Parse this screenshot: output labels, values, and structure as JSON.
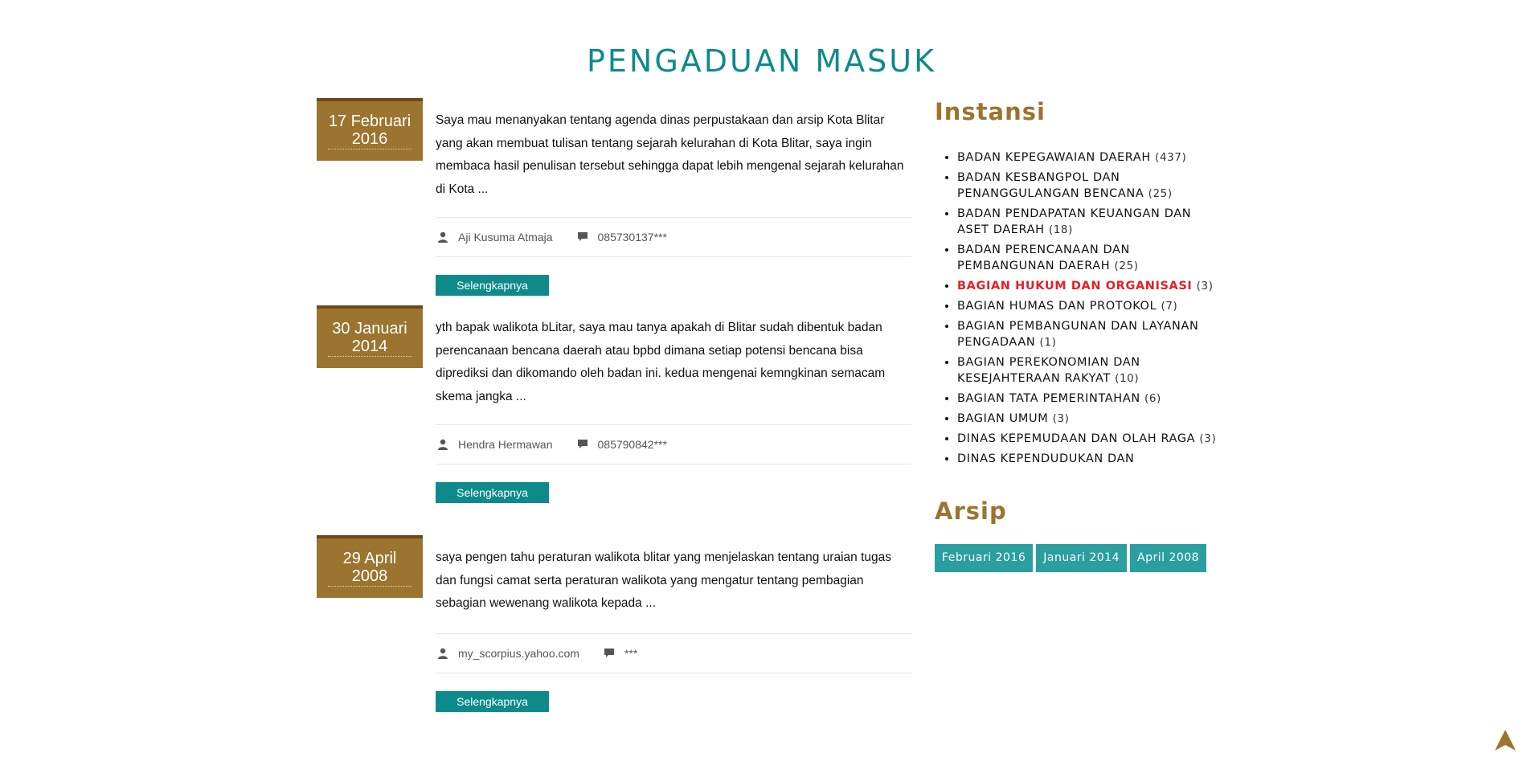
{
  "page": {
    "title": "PENGADUAN MASUK"
  },
  "posts": [
    {
      "date_line1": "17 Februari",
      "date_line2": "2016",
      "excerpt": "Saya mau menanyakan tentang agenda dinas perpustakaan dan arsip Kota Blitar yang akan membuat tulisan tentang sejarah kelurahan di Kota Blitar, saya ingin membaca hasil penulisan tersebut sehingga dapat lebih mengenal sejarah kelurahan di Kota ...",
      "author": "Aji Kusuma Atmaja",
      "phone": "085730137***",
      "button": "Selengkapnya"
    },
    {
      "date_line1": "30 Januari",
      "date_line2": "2014",
      "excerpt": "yth bapak walikota bLitar, saya mau tanya apakah di Blitar sudah dibentuk badan perencanaan bencana daerah atau bpbd dimana setiap potensi bencana bisa diprediksi dan dikomando oleh badan ini. kedua mengenai kemngkinan semacam skema jangka ...",
      "author": "Hendra Hermawan",
      "phone": "085790842***",
      "button": "Selengkapnya"
    },
    {
      "date_line1": "29 April",
      "date_line2": "2008",
      "excerpt": "saya pengen tahu peraturan walikota blitar yang menjelaskan tentang uraian tugas dan fungsi camat serta peraturan walikota yang mengatur tentang pembagian sebagian wewenang walikota kepada ...",
      "author": "my_scorpius.yahoo.com",
      "phone": "***",
      "button": "Selengkapnya"
    }
  ],
  "sidebar": {
    "instansi_heading": "Instansi",
    "instansi": [
      {
        "name": "BADAN KEPEGAWAIAN DAERAH",
        "count": "(437)"
      },
      {
        "name": "BADAN KESBANGPOL DAN PENANGGULANGAN BENCANA",
        "count": "(25)"
      },
      {
        "name": "BADAN PENDAPATAN KEUANGAN DAN ASET DAERAH",
        "count": "(18)"
      },
      {
        "name": "BADAN PERENCANAAN DAN PEMBANGUNAN DAERAH",
        "count": "(25)"
      },
      {
        "name": "BAGIAN HUKUM DAN ORGANISASI",
        "count": "(3)",
        "active": true
      },
      {
        "name": "BAGIAN HUMAS DAN PROTOKOL",
        "count": "(7)"
      },
      {
        "name": "BAGIAN PEMBANGUNAN DAN LAYANAN PENGADAAN",
        "count": "(1)"
      },
      {
        "name": "BAGIAN PEREKONOMIAN DAN KESEJAHTERAAN RAKYAT",
        "count": "(10)"
      },
      {
        "name": "BAGIAN TATA PEMERINTAHAN",
        "count": "(6)"
      },
      {
        "name": "BAGIAN UMUM",
        "count": "(3)"
      },
      {
        "name": "DINAS KEPEMUDAAN DAN OLAH RAGA",
        "count": "(3)"
      },
      {
        "name": "DINAS KEPENDUDUKAN DAN",
        "count": ""
      }
    ],
    "arsip_heading": "Arsip",
    "arsip": [
      "Februari 2016",
      "Januari 2014",
      "April 2008"
    ]
  },
  "colors": {
    "teal": "#0e8a8a",
    "gold": "#9b742f",
    "active_red": "#e0202a",
    "archive_teal": "#2a9ea0"
  },
  "icons": {
    "author": "user-icon",
    "phone": "comment-icon",
    "scroll_top": "arrow-up-icon"
  }
}
